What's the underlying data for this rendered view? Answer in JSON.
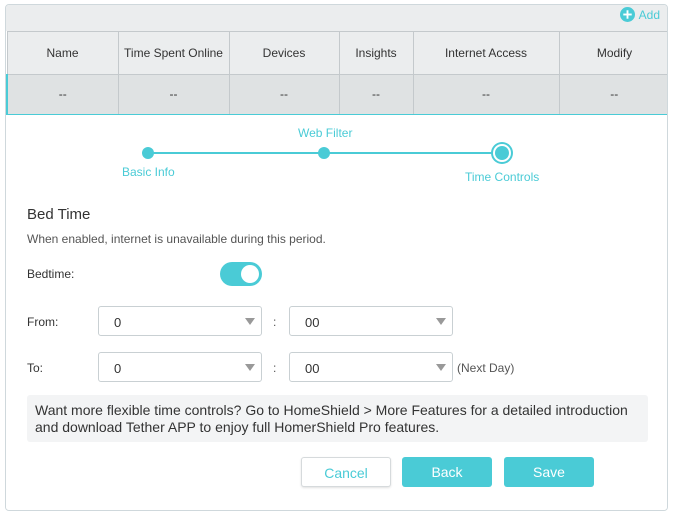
{
  "toolbar": {
    "add_label": "Add"
  },
  "table": {
    "headers": [
      "Name",
      "Time Spent Online",
      "Devices",
      "Insights",
      "Internet Access",
      "Modify"
    ],
    "row": [
      "--",
      "--",
      "--",
      "--",
      "--",
      "--"
    ]
  },
  "stepper": {
    "steps": [
      "Basic Info",
      "Web Filter",
      "Time Controls"
    ],
    "current": "Time Controls"
  },
  "bedtime": {
    "title": "Bed Time",
    "description": "When enabled, internet is unavailable during this period.",
    "toggle_label": "Bedtime:",
    "enabled": true,
    "from_label": "From:",
    "from_hour": "0",
    "from_minute": "00",
    "to_label": "To:",
    "to_hour": "0",
    "to_minute": "00",
    "colon": ":",
    "next_day": "(Next Day)"
  },
  "notice": {
    "text": "Want more flexible time controls? Go to HomeShield > More Features for a detailed introduction and download Tether APP to enjoy full HomerShield Pro features."
  },
  "buttons": {
    "cancel": "Cancel",
    "back": "Back",
    "save": "Save"
  },
  "colors": {
    "accent": "#4acbd6",
    "header_bg": "#ebedee",
    "row_bg": "#dfe2e3"
  }
}
